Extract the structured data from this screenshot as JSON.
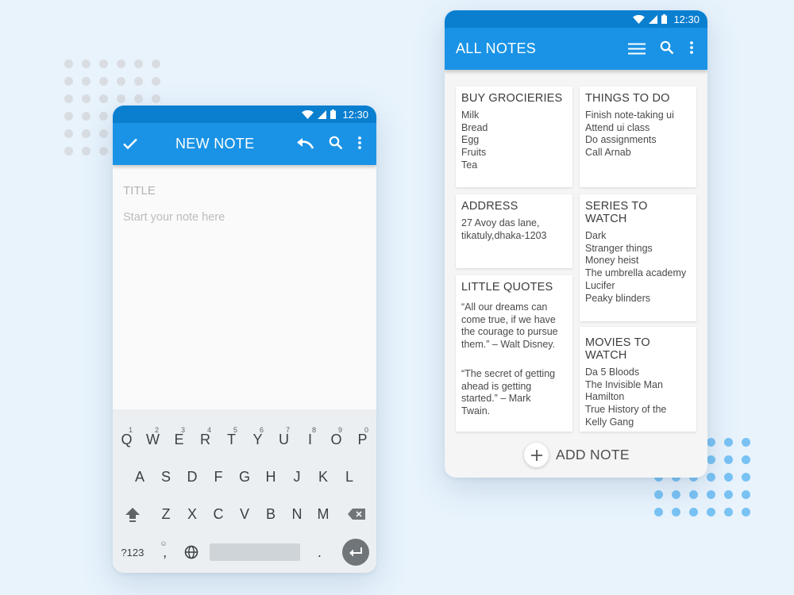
{
  "colors": {
    "primary": "#1a93e6",
    "status_bar": "#0a7fd0",
    "accent_dots": "#79c2f4"
  },
  "new_note_screen": {
    "status_time": "12:30",
    "title": "NEW NOTE",
    "icons": [
      "check-icon",
      "undo-icon",
      "search-icon",
      "more-vertical-icon"
    ],
    "title_placeholder": "TITLE",
    "body_placeholder": "Start your note here",
    "keyboard": {
      "row1": [
        {
          "key": "Q",
          "hint": "1"
        },
        {
          "key": "W",
          "hint": "2"
        },
        {
          "key": "E",
          "hint": "3"
        },
        {
          "key": "R",
          "hint": "4"
        },
        {
          "key": "T",
          "hint": "5"
        },
        {
          "key": "Y",
          "hint": "6"
        },
        {
          "key": "U",
          "hint": "7"
        },
        {
          "key": "I",
          "hint": "8"
        },
        {
          "key": "O",
          "hint": "9"
        },
        {
          "key": "P",
          "hint": "0"
        }
      ],
      "row2": [
        "A",
        "S",
        "D",
        "F",
        "G",
        "H",
        "J",
        "K",
        "L"
      ],
      "row3": [
        "Z",
        "X",
        "C",
        "V",
        "B",
        "N",
        "M"
      ],
      "symbols_key": "?123",
      "comma_key": ",",
      "period_key": "."
    }
  },
  "all_notes_screen": {
    "status_time": "12:30",
    "title": "ALL NOTES",
    "icons": [
      "list-icon",
      "search-icon",
      "more-vertical-icon"
    ],
    "notes": {
      "groceries": {
        "title": "BUY GROCIERIES",
        "lines": [
          "Milk",
          "Bread",
          "Egg",
          "Fruits",
          "Tea"
        ]
      },
      "todo": {
        "title": "THINGS TO DO",
        "lines": [
          "Finish note-taking ui",
          "Attend ui class",
          "Do assignments",
          "Call Arnab"
        ]
      },
      "address": {
        "title": "ADDRESS",
        "lines": [
          "27 Avoy das lane,",
          "tikatuly,dhaka-1203"
        ]
      },
      "series": {
        "title": "SERIES TO WATCH",
        "lines": [
          "Dark",
          "Stranger things",
          "Money heist",
          "The umbrella academy",
          "Lucifer",
          "Peaky blinders"
        ]
      },
      "quotes": {
        "title": "LITTLE QUOTES",
        "quote1": [
          "“All our dreams can",
          "come true, if we have",
          "the courage to pursue",
          "them.” – Walt Disney."
        ],
        "quote2": [
          "“The secret of getting",
          "ahead is getting",
          "started.” – Mark",
          "Twain."
        ]
      },
      "movies": {
        "title": "MOVIES TO WATCH",
        "lines": [
          "Da 5 Bloods",
          "The Invisible Man",
          "Hamilton",
          "True History of the",
          "Kelly Gang"
        ]
      }
    },
    "add_note_label": "ADD NOTE"
  }
}
